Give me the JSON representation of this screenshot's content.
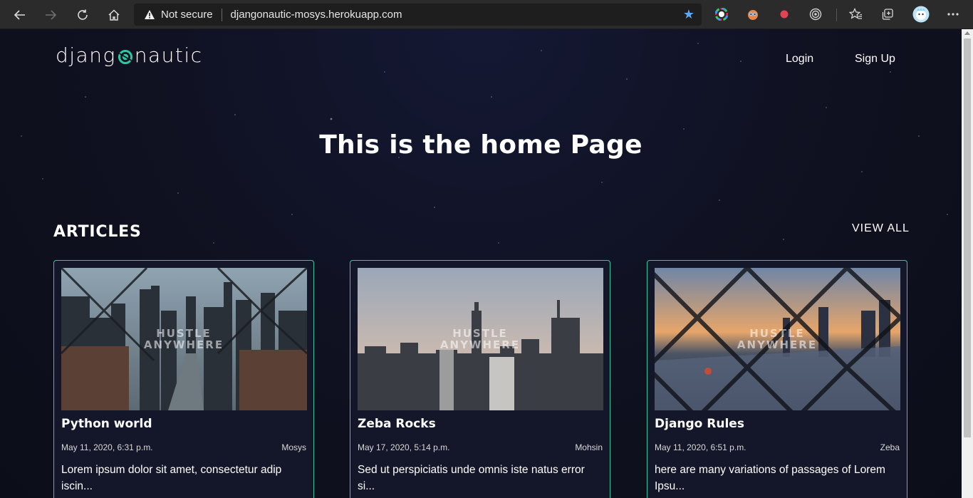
{
  "browser": {
    "security_label": "Not secure",
    "url": "djangonautic-mosys.herokuapp.com",
    "icons": [
      "back-icon",
      "forward-icon",
      "reload-icon",
      "home-icon",
      "warning-icon",
      "favorite-star-icon",
      "color-wheel-extension-icon",
      "owl-extension-icon",
      "record-extension-icon",
      "target-extension-icon",
      "favorites-icon",
      "collections-icon",
      "profile-avatar-icon",
      "more-menu-icon"
    ]
  },
  "site": {
    "logo_left": "djang",
    "logo_right": "nautic",
    "nav": {
      "login": "Login",
      "signup": "Sign Up"
    },
    "hero_title": "This is the home Page",
    "section_title": "ARTICLES",
    "view_all": "VIEW ALL",
    "accent_color": "#2cc9a0",
    "background_color": "#0f1120"
  },
  "articles": [
    {
      "title": "Python world",
      "date": "May 11, 2020, 6:31 p.m.",
      "author": "Mosys",
      "excerpt": "Lorem ipsum dolor sit amet, consectetur adip iscin...",
      "image_text_1": "HUSTLE",
      "image_text_2": "ANYWHERE"
    },
    {
      "title": "Zeba Rocks",
      "date": "May 17, 2020, 5:14 p.m.",
      "author": "Mohsin",
      "excerpt": "Sed ut perspiciatis unde omnis iste natus error si...",
      "image_text_1": "HUSTLE",
      "image_text_2": "ANYWHERE"
    },
    {
      "title": "Django Rules",
      "date": "May 11, 2020, 6:51 p.m.",
      "author": "Zeba",
      "excerpt": "here are many variations of passages of Lorem Ipsu...",
      "image_text_1": "HUSTLE",
      "image_text_2": "ANYWHERE"
    }
  ]
}
